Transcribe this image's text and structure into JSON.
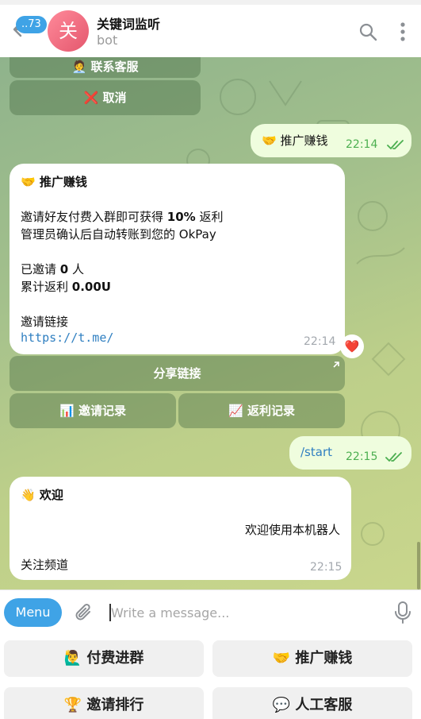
{
  "header": {
    "unread_count": "..73",
    "avatar_letter": "关",
    "title": "关键词监听",
    "subtitle": "bot"
  },
  "chat": {
    "top_buttons": [
      {
        "icon": "🧑‍💼",
        "label": "联系客服"
      },
      {
        "icon": "❌",
        "label": "取消"
      }
    ],
    "out_msg_1": {
      "text": "🤝 推广赚钱",
      "time": "22:14"
    },
    "promo_msg": {
      "title": "🤝 推广赚钱",
      "line1_pre": "邀请好友付费入群即可获得 ",
      "line1_bold": "10%",
      "line1_post": " 返利",
      "line2": "管理员确认后自动转账到您的 OkPay",
      "invited_pre": "已邀请 ",
      "invited_count": "0",
      "invited_post": " 人",
      "rebate_pre": "累计返利 ",
      "rebate_amount": "0.00U",
      "link_label": "邀请链接",
      "link": "https://t.me/",
      "time": "22:14",
      "reaction": "❤️"
    },
    "promo_buttons": {
      "share": "分享链接",
      "invite_records_icon": "📊",
      "invite_records": "邀请记录",
      "rebate_records_icon": "📈",
      "rebate_records": "返利记录"
    },
    "out_msg_2": {
      "text": "/start",
      "time": "22:15"
    },
    "welcome_msg": {
      "title": "👋 欢迎",
      "center_text": "欢迎使用本机器人",
      "follow": "关注频道",
      "time": "22:15"
    }
  },
  "composer": {
    "menu_label": "Menu",
    "placeholder": "Write a message..."
  },
  "keyboard": {
    "keys": [
      {
        "icon": "🙋‍♂️",
        "label": "付费进群"
      },
      {
        "icon": "🤝",
        "label": "推广赚钱"
      },
      {
        "icon": "🏆",
        "label": "邀请排行"
      },
      {
        "icon": "💬",
        "label": "人工客服"
      }
    ]
  },
  "colors": {
    "accent": "#3fa3e6",
    "outgoing_bubble": "#effdde",
    "check_green": "#4caf50",
    "avatar": "#e4576d"
  }
}
